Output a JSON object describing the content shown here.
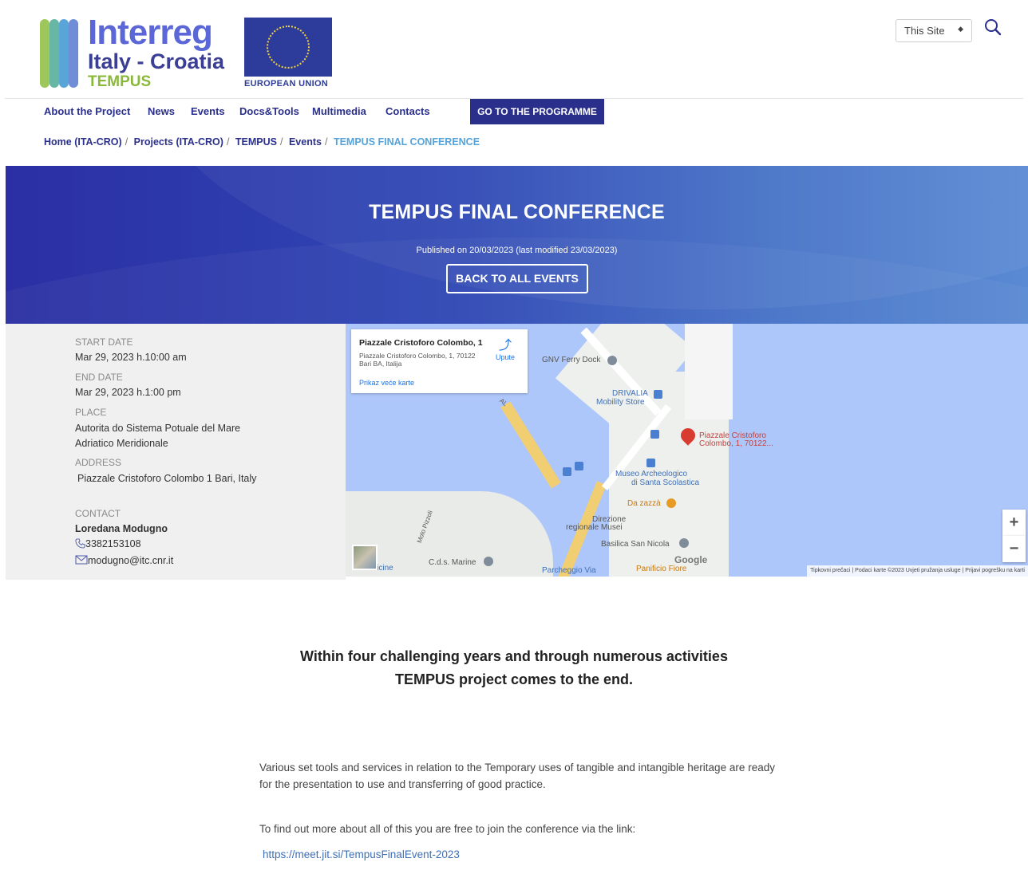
{
  "header": {
    "logo": {
      "brand": "Interreg",
      "region": "Italy - Croatia",
      "project": "TEMPUS",
      "eu_label": "EUROPEAN UNION"
    },
    "search": {
      "scope": "This Site"
    }
  },
  "nav": {
    "items": [
      "About the Project",
      "News",
      "Events",
      "Docs&Tools",
      "Multimedia",
      "Contacts"
    ],
    "programme_button": "GO TO THE PROGRAMME"
  },
  "breadcrumb": [
    "Home (ITA-CRO)",
    "Projects (ITA-CRO)",
    "TEMPUS",
    "Events",
    "TEMPUS FINAL CONFERENCE"
  ],
  "hero": {
    "title": "TEMPUS FINAL CONFERENCE",
    "published": "Published on 20/03/2023 (last modified 23/03/2023)",
    "back_button": "BACK TO ALL EVENTS"
  },
  "event": {
    "start_label": "START DATE",
    "start_value": "Mar 29, 2023 h.10:00 am",
    "end_label": "END DATE",
    "end_value": "Mar 29, 2023 h.1:00 pm",
    "place_label": "PLACE",
    "place_line1": "Autorita do Sistema Potuale del Mare",
    "place_line2": "Adriatico Meridionale",
    "address_label": "ADDRESS",
    "address_value": "Piazzale Cristoforo Colombo 1  Bari, Italy",
    "contact_label": "CONTACT",
    "contact_name": "Loredana Modugno",
    "contact_phone": "3382153108",
    "contact_email": "modugno@itc.cnr.it"
  },
  "map": {
    "card_title": "Piazzale Cristoforo Colombo, 1",
    "card_address": "Piazzale Cristoforo Colombo, 1, 70122 Bari BA, Italija",
    "card_link": "Prikaz veće karte",
    "directions": "Upute",
    "labels": {
      "ferry": "GNV Ferry Dock",
      "drivalia1": "DRIVALIA",
      "drivalia2": "Mobility Store",
      "pin1": "Piazzale Cristoforo",
      "pin2": "Colombo, 1, 70122...",
      "museo1": "Museo Archeologico",
      "museo2": "di Santa Scolastica",
      "dazazza": "Da zazzà",
      "direzione1": "Direzione",
      "direzione2": "regionale Musei",
      "basilica": "Basilica San Nicola",
      "panificio": "Panificio Fiore",
      "parcheggio": "Parcheggio Via",
      "cds": "C.d.s. Marine",
      "officine": "Officine",
      "molo": "Molo Pizzoli",
      "road": "AL"
    },
    "google": "Google",
    "attribution": "Tipkovni prečaci  |  Podaci karte ©2023   Uvjeti pružanja usluge  |  Prijavi pogrešku na karti",
    "zoom_in": "+",
    "zoom_out": "−"
  },
  "content": {
    "intro_line1": "Within four challenging years and through numerous activities",
    "intro_line2": "TEMPUS project comes to the end.",
    "para1": "Various set tools and services in relation to the Temporary uses of tangible and intangible heritage are ready for the presentation to use and transferring of good practice.",
    "para2": "To find out more about all of this you are free to join the conference via the link:",
    "link": "https://meet.jit.si/TempusFinalEvent-2023"
  },
  "colors": {
    "brand_navy": "#2a2f8c",
    "breadcrumb_current": "#56a3d9",
    "hero_start": "#2b2fa3",
    "hero_end": "#5a8ad3",
    "water": "#aec7fb"
  }
}
